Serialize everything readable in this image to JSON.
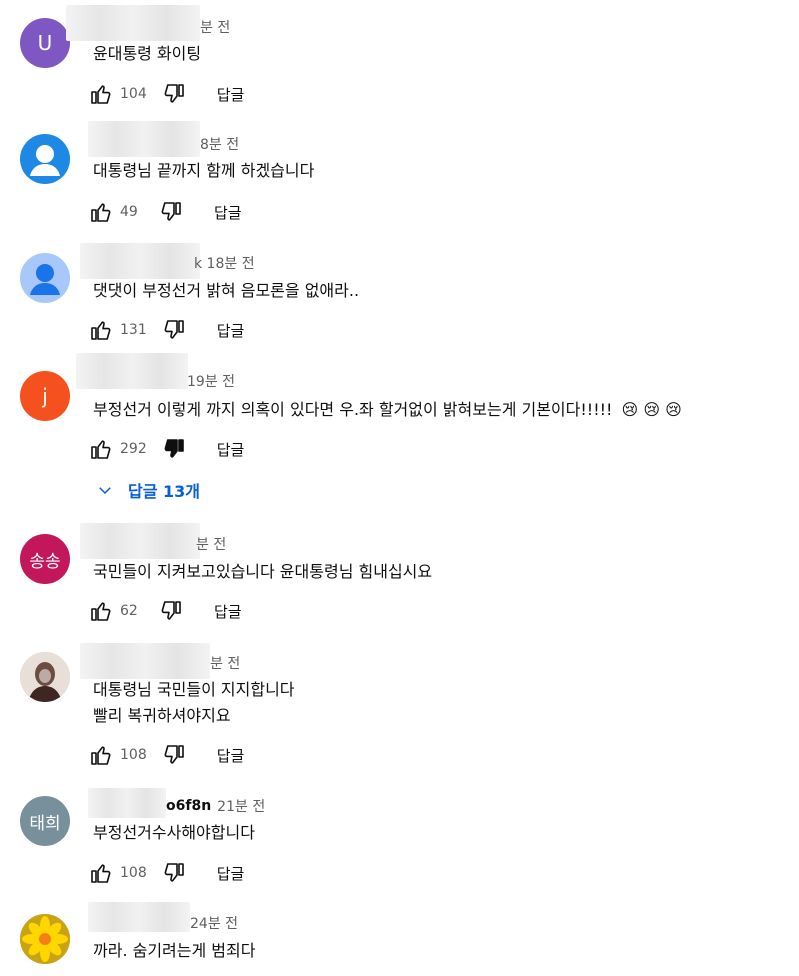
{
  "comments": [
    {
      "avatar_letter": "U",
      "avatar_color": "#7e57c2",
      "author_suffix": "분 전",
      "text": "윤대통령 화이팅",
      "likes": "104",
      "reply_label": "답글"
    },
    {
      "avatar_icon": "person-icon",
      "avatar_color": "#1e88e5",
      "author_suffix": "8분 전",
      "text": "대통령님 끝까지 함께 하겠습니다",
      "likes": "49",
      "reply_label": "답글"
    },
    {
      "avatar_icon": "person-icon",
      "avatar_color": "#a8c7fa",
      "author_suffix": "k 18분 전",
      "text": "댓댓이 부정선거 밝혀  음모론을  없애라..",
      "likes": "131",
      "reply_label": "답글"
    },
    {
      "avatar_letter": "j",
      "avatar_color": "#f4511e",
      "author_suffix": "19분 전",
      "text": "부정선거 이렇게 까지 의혹이 있다면 우.좌 할거없이 밝혀보는게 기본이다!!!!!",
      "emoji": "😢 😢 😢",
      "likes": "292",
      "reply_label": "답글",
      "replies_label": "답글 13개"
    },
    {
      "avatar_letter": "송송",
      "avatar_color": "#c2185b",
      "author_suffix": "분 전",
      "text": "국민들이 지켜보고있습니다 윤대통령님 힘내십시요",
      "likes": "62",
      "reply_label": "답글"
    },
    {
      "avatar_icon": "photo-avatar",
      "avatar_color": "#5d4037",
      "author_suffix": "분 전",
      "text_line1": "대통령님 국민들이 지지합니다",
      "text_line2": "빨리 복귀하셔야지요",
      "likes": "108",
      "reply_label": "답글"
    },
    {
      "avatar_letter": "태희",
      "avatar_color": "#78909c",
      "author_name": "o6f8n",
      "author_suffix": "21분 전",
      "text": "부정선거수사해야합니다",
      "likes": "108",
      "reply_label": "답글"
    },
    {
      "avatar_icon": "flower-avatar",
      "avatar_color": "#f9a825",
      "author_suffix": "24분 전",
      "text": "까라. 숨기려는게 범죄다"
    }
  ]
}
